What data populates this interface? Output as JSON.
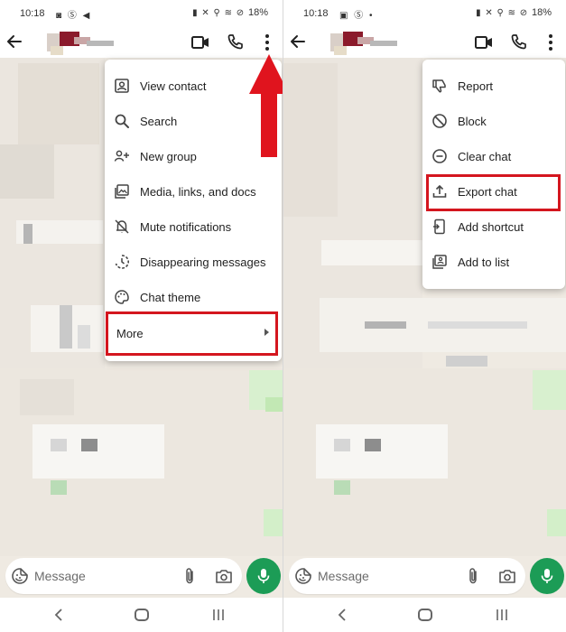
{
  "status_bar": {
    "left": {
      "time": "10:18",
      "icons": "◙ Ⓢ ◀"
    },
    "right": {
      "time": "10:18",
      "icons": "▣ Ⓢ •"
    },
    "system_icons": "▮ ✕ ⚲ ≋ ⊘",
    "battery": "18%"
  },
  "composer": {
    "placeholder": "Message"
  },
  "menu_left": {
    "items": [
      {
        "label": "View contact",
        "icon": "contact-card-icon"
      },
      {
        "label": "Search",
        "icon": "search-icon"
      },
      {
        "label": "New group",
        "icon": "add-group-icon"
      },
      {
        "label": "Media, links, and docs",
        "icon": "media-gallery-icon"
      },
      {
        "label": "Mute notifications",
        "icon": "bell-off-icon"
      },
      {
        "label": "Disappearing messages",
        "icon": "timer-icon"
      },
      {
        "label": "Chat theme",
        "icon": "palette-icon"
      },
      {
        "label": "More",
        "icon": "chevron-right-icon"
      }
    ]
  },
  "menu_right": {
    "items": [
      {
        "label": "Report",
        "icon": "thumbs-down-icon"
      },
      {
        "label": "Block",
        "icon": "block-icon"
      },
      {
        "label": "Clear chat",
        "icon": "minus-circle-icon"
      },
      {
        "label": "Export chat",
        "icon": "upload-icon"
      },
      {
        "label": "Add shortcut",
        "icon": "shortcut-icon"
      },
      {
        "label": "Add to list",
        "icon": "list-icon"
      }
    ]
  },
  "colors": {
    "accent_green": "#1c9c56",
    "highlight_red": "#d4161f",
    "chat_background": "#efeae2"
  }
}
